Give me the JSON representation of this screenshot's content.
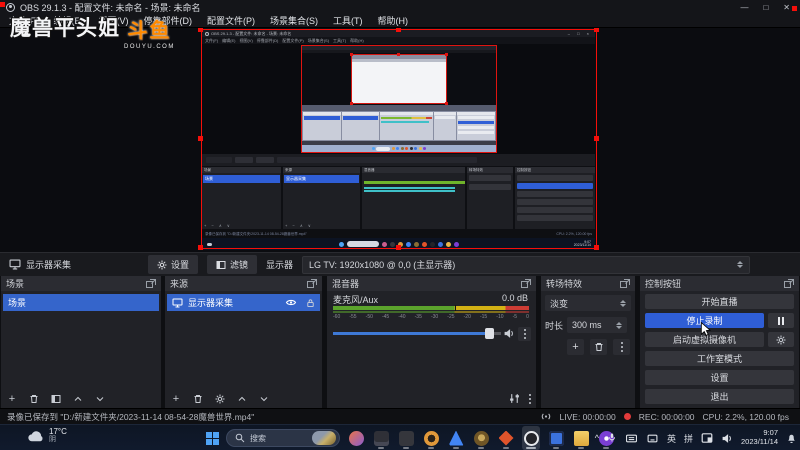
{
  "window": {
    "title": "OBS 29.1.3 - 配置文件: 未命名 - 场景: 未命名",
    "minimize": "—",
    "maximize": "□",
    "close": "✕"
  },
  "menu": {
    "items": [
      "文件(F)",
      "编辑(E)",
      "视图(V)",
      "停靠部件(D)",
      "配置文件(P)",
      "场景集合(S)",
      "工具(T)",
      "帮助(H)"
    ]
  },
  "watermark": {
    "name": "魔兽平头姐",
    "brand": "斗鱼",
    "brand_domain": "DOUYU.COM"
  },
  "source_bar": {
    "source": "显示器采集",
    "settings": "设置",
    "filters": "滤镜",
    "display_label": "显示器",
    "display_value": "LG TV: 1920x1080 @ 0,0 (主显示器)"
  },
  "scenes": {
    "title": "场景",
    "items": [
      "场景"
    ]
  },
  "sources": {
    "title": "来源",
    "items": [
      "显示器采集"
    ]
  },
  "mixer": {
    "title": "混音器",
    "channel": "麦克风/Aux",
    "level": "0.0 dB",
    "ticks": [
      "-60",
      "-55",
      "-50",
      "-45",
      "-40",
      "-35",
      "-30",
      "-25",
      "-20",
      "-15",
      "-10",
      "-5",
      "0"
    ]
  },
  "transitions": {
    "title": "转场特效",
    "value": "淡变",
    "duration_label": "时长",
    "duration_value": "300 ms"
  },
  "controls": {
    "title": "控制按钮",
    "start_stream": "开始直播",
    "stop_record": "停止录制",
    "virtual_cam": "启动虚拟摄像机",
    "studio_mode": "工作室模式",
    "settings": "设置",
    "exit": "退出"
  },
  "status": {
    "message": "录像已保存到 \"D:/新建文件夹/2023-11-14 08-54-28魔兽世界.mp4\"",
    "live": "LIVE: 00:00:00",
    "rec": "REC: 00:00:00",
    "cpu": "CPU: 2.2%, 120.00 fps"
  },
  "taskbar": {
    "temp": "17°C",
    "condition": "阴",
    "search": "搜索",
    "tray_expand": "^",
    "ime_lang": "英",
    "ime_mode": "拼",
    "time": "9:07",
    "date": "2023/11/14"
  },
  "colors": {
    "accent": "#3565cb",
    "record_red": "#e23b3b",
    "selection_red": "#f50f0a"
  }
}
